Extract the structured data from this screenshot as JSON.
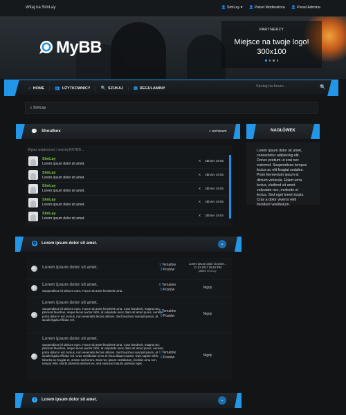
{
  "topbar": {
    "welcome": "Witaj na SimLay",
    "user_link": "SimLay ▾",
    "mod_link": "Panel Moderatora",
    "admin_link": "Panel Admina"
  },
  "header": {
    "logo_text": "MyBB",
    "partner_label": "PARTNERZY",
    "partner_title_1": "Miejsce na twoje logo!",
    "partner_title_2": "300x100"
  },
  "nav": {
    "items": [
      {
        "icon": "home-icon",
        "label": "HOME"
      },
      {
        "icon": "users-icon",
        "label": "UŻYTKOWNICY"
      },
      {
        "icon": "search-icon",
        "label": "SZUKAJ"
      },
      {
        "icon": "rules-icon",
        "label": "REGULAMINY"
      }
    ],
    "search_placeholder": "Szukaj na forum..."
  },
  "breadcrumb": "SimLay",
  "shoutbox": {
    "title": "Shoutbox",
    "archive": "» archiwum",
    "input_placeholder": "Wpisz wiadomość i wciśnij ENTER...",
    "rows": [
      {
        "user": "SimLay",
        "message": "Lorem ipsum dolor sit amet.",
        "actions": "X X",
        "date": "20 Nov 19:55"
      },
      {
        "user": "SimLay",
        "message": "Lorem ipsum dolor sit amet.",
        "actions": "X X",
        "date": "20 Nov 19:55"
      },
      {
        "user": "SimLay",
        "message": "Lorem ipsum dolor sit amet.",
        "actions": "X X",
        "date": "20 Nov 19:55"
      },
      {
        "user": "SimLay",
        "message": "Lorem ipsum dolor sit amet.",
        "actions": "X X",
        "date": "20 Nov 19:55"
      },
      {
        "user": "SimLay",
        "message": "Lorem ipsum dolor sit amet.",
        "actions": "X X",
        "date": "20 Nov 19:54"
      }
    ]
  },
  "sidebar": {
    "title": "NAGŁÓWEK",
    "body": "Lorem ipsum dolor sit amet, consectetur adipiscing elit. Donec pretium ut erat nec euismod. Suspendisse tempus lectus ac elit feugiat sodales. Proin fermentum ipsum et dictum vehicula. Etiam urna lectus, eleifend sit amet vulputate nec, molestie et lectus. Sed eget lorem turpis. Cras a dolor viverra velit tincidunt vestibulum."
  },
  "categories": [
    {
      "icon": "globe-icon",
      "title": "Lorem ipsum dolor sit amet."
    },
    {
      "icon": "info-icon",
      "title": "Lorem ipsum dolor sit amet."
    }
  ],
  "forums": [
    {
      "title": "Lorem ipsum dolor sit amet.",
      "desc": "",
      "threads": "1",
      "threads_label": "Tematów",
      "posts": "3",
      "posts_label": "Postów",
      "last_title": "Lorem ipsum dolor sit amet...",
      "last_date": "11-12-2017 05:52 PM",
      "last_by": "przez",
      "last_user": "SimLay",
      "never": ""
    },
    {
      "title": "Lorem ipsum dolor sit amet.",
      "desc": "Suspendisse id ultrices nunc. Fusce sit amet hendrerit urna.",
      "threads": "0",
      "threads_label": "Tematów",
      "posts": "0",
      "posts_label": "Postów",
      "never": "Nigdy"
    },
    {
      "title": "Lorem ipsum dolor sit amet.",
      "desc": "Suspendisse id ultrices nunc. Fusce sit amet hendrerit urna. Cras hendrerit, magna nec placerat faucibus, neque lacus auctor nibh, at vulputate nunc diam sit amet purus. Aenean porta dolor in est cursus, non venenatis lectus ultrices. Sed faucibus suscipit ipsum, at iaculis ligula efficitur vel.",
      "threads": "0",
      "threads_label": "Tematów",
      "posts": "0",
      "posts_label": "Postów",
      "never": "Nigdy"
    },
    {
      "title": "Lorem ipsum dolor sit amet.",
      "desc": "Suspendisse id ultrices nunc. Fusce sit amet hendrerit urna. Cras hendrerit, magna nec placerat faucibus, neque lacus auctor nibh, at vulputate nunc diam sit amet purus. Aenean porta dolor in est cursus, non venenatis lectus ultrices. Sed faucibus suscipit ipsum, at iaculis ligula efficitur vel. Cras vestibulum eros et risus aliquet auctor. Duis sapien nibh, lobortis ac feugiat et, ornare sed lorem. Duis nec ipsum vestibulum, facilisis urna non, tempor felis. Morbi pharetra ultricies ex, sed euismod mauris pulvinar eget.",
      "threads": "0",
      "threads_label": "Tematów",
      "posts": "0",
      "posts_label": "Postów",
      "never": "Nigdy"
    }
  ],
  "colors": {
    "accent": "#2396e8",
    "username": "#7ac943",
    "background": "#121416"
  }
}
